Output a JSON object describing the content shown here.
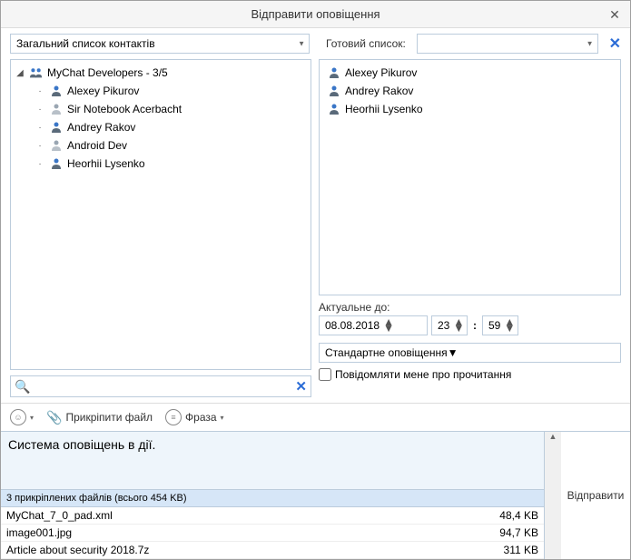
{
  "window": {
    "title": "Відправити оповіщення"
  },
  "contacts_dropdown": {
    "selected": "Загальний список контактів"
  },
  "ready_list": {
    "label": "Готовий список:",
    "selected": ""
  },
  "group": {
    "name": "MyChat Developers - 3/5"
  },
  "contacts": [
    {
      "name": "Alexey Pikurov",
      "online": true
    },
    {
      "name": "Sir Notebook Acerbacht",
      "online": false
    },
    {
      "name": "Andrey Rakov",
      "online": true
    },
    {
      "name": "Android Dev",
      "online": false
    },
    {
      "name": "Heorhii Lysenko",
      "online": true
    }
  ],
  "selected_contacts": [
    {
      "name": "Alexey Pikurov"
    },
    {
      "name": "Andrey Rakov"
    },
    {
      "name": "Heorhii Lysenko"
    }
  ],
  "valid_until": {
    "label": "Актуальне до:",
    "date": "08.08.2018",
    "hour": "23",
    "minute": "59"
  },
  "notification_type": {
    "selected": "Стандартне оповіщення"
  },
  "read_notify": {
    "label": "Повідомляти мене про прочитання"
  },
  "toolbar": {
    "attach": "Прикріпити файл",
    "phrase": "Фраза"
  },
  "message": {
    "text": "Система оповіщень в дії."
  },
  "attachments_header": "3 прикріплених файлів (всього 454 KB)",
  "files": [
    {
      "name": "MyChat_7_0_pad.xml",
      "size": "48,4 KB"
    },
    {
      "name": "image001.jpg",
      "size": "94,7 KB"
    },
    {
      "name": "Article about security 2018.7z",
      "size": "311 KB"
    }
  ],
  "send_button": "Відправити"
}
